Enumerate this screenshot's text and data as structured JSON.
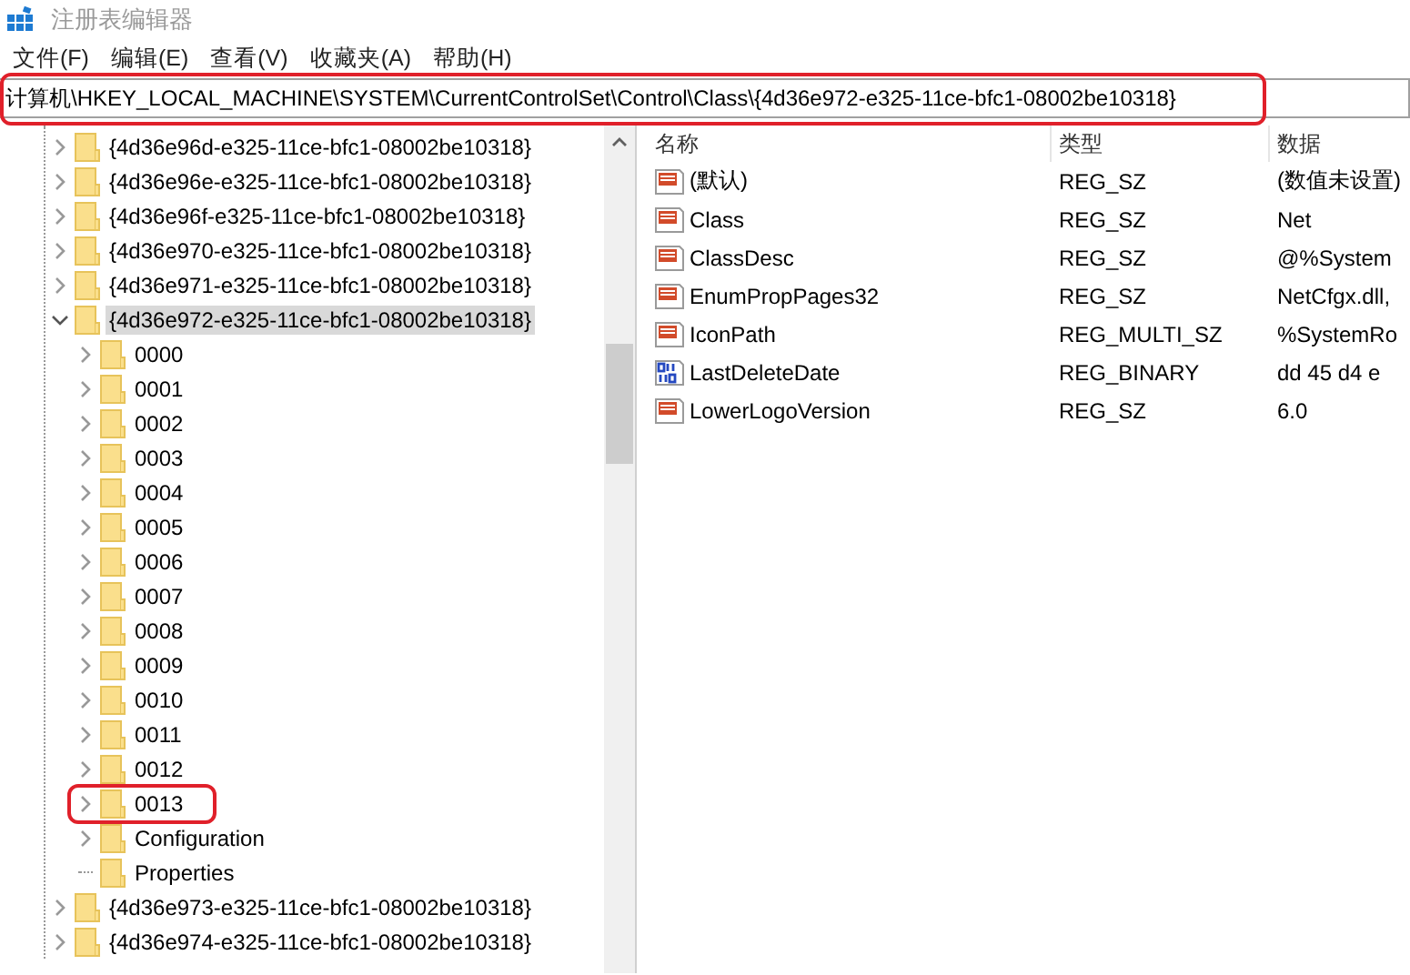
{
  "window": {
    "title": "注册表编辑器"
  },
  "menu": [
    {
      "label": "文件(F)"
    },
    {
      "label": "编辑(E)"
    },
    {
      "label": "查看(V)"
    },
    {
      "label": "收藏夹(A)"
    },
    {
      "label": "帮助(H)"
    }
  ],
  "address_bar": {
    "value": "计算机\\HKEY_LOCAL_MACHINE\\SYSTEM\\CurrentControlSet\\Control\\Class\\{4d36e972-e325-11ce-bfc1-08002be10318}",
    "annotated": true
  },
  "tree": [
    {
      "label": "{4d36e96d-e325-11ce-bfc1-08002be10318}",
      "expanded": false,
      "selected": false,
      "annotated": false,
      "has_children": true
    },
    {
      "label": "{4d36e96e-e325-11ce-bfc1-08002be10318}",
      "expanded": false,
      "selected": false,
      "annotated": false,
      "has_children": true
    },
    {
      "label": "{4d36e96f-e325-11ce-bfc1-08002be10318}",
      "expanded": false,
      "selected": false,
      "annotated": false,
      "has_children": true
    },
    {
      "label": "{4d36e970-e325-11ce-bfc1-08002be10318}",
      "expanded": false,
      "selected": false,
      "annotated": false,
      "has_children": true
    },
    {
      "label": "{4d36e971-e325-11ce-bfc1-08002be10318}",
      "expanded": false,
      "selected": false,
      "annotated": false,
      "has_children": true
    },
    {
      "label": "{4d36e972-e325-11ce-bfc1-08002be10318}",
      "expanded": true,
      "selected": true,
      "annotated": false,
      "has_children": true,
      "children": [
        {
          "label": "0000",
          "expanded": false,
          "selected": false,
          "annotated": false,
          "has_children": true
        },
        {
          "label": "0001",
          "expanded": false,
          "selected": false,
          "annotated": false,
          "has_children": true
        },
        {
          "label": "0002",
          "expanded": false,
          "selected": false,
          "annotated": false,
          "has_children": true
        },
        {
          "label": "0003",
          "expanded": false,
          "selected": false,
          "annotated": false,
          "has_children": true
        },
        {
          "label": "0004",
          "expanded": false,
          "selected": false,
          "annotated": false,
          "has_children": true
        },
        {
          "label": "0005",
          "expanded": false,
          "selected": false,
          "annotated": false,
          "has_children": true
        },
        {
          "label": "0006",
          "expanded": false,
          "selected": false,
          "annotated": false,
          "has_children": true
        },
        {
          "label": "0007",
          "expanded": false,
          "selected": false,
          "annotated": false,
          "has_children": true
        },
        {
          "label": "0008",
          "expanded": false,
          "selected": false,
          "annotated": false,
          "has_children": true
        },
        {
          "label": "0009",
          "expanded": false,
          "selected": false,
          "annotated": false,
          "has_children": true
        },
        {
          "label": "0010",
          "expanded": false,
          "selected": false,
          "annotated": false,
          "has_children": true
        },
        {
          "label": "0011",
          "expanded": false,
          "selected": false,
          "annotated": false,
          "has_children": true
        },
        {
          "label": "0012",
          "expanded": false,
          "selected": false,
          "annotated": false,
          "has_children": true
        },
        {
          "label": "0013",
          "expanded": false,
          "selected": false,
          "annotated": true,
          "has_children": true
        },
        {
          "label": "Configuration",
          "expanded": false,
          "selected": false,
          "annotated": false,
          "has_children": true
        },
        {
          "label": "Properties",
          "selected": false,
          "annotated": false,
          "has_children": false
        }
      ]
    },
    {
      "label": "{4d36e973-e325-11ce-bfc1-08002be10318}",
      "expanded": false,
      "selected": false,
      "annotated": false,
      "has_children": true
    },
    {
      "label": "{4d36e974-e325-11ce-bfc1-08002be10318}",
      "expanded": false,
      "selected": false,
      "annotated": false,
      "has_children": true
    }
  ],
  "values": {
    "columns": [
      "名称",
      "类型",
      "数据"
    ],
    "rows": [
      {
        "kind": "string",
        "name": "(默认)",
        "type": "REG_SZ",
        "data": "(数值未设置)"
      },
      {
        "kind": "string",
        "name": "Class",
        "type": "REG_SZ",
        "data": "Net"
      },
      {
        "kind": "string",
        "name": "ClassDesc",
        "type": "REG_SZ",
        "data": "@%System"
      },
      {
        "kind": "string",
        "name": "EnumPropPages32",
        "type": "REG_SZ",
        "data": "NetCfgx.dll,"
      },
      {
        "kind": "string",
        "name": "IconPath",
        "type": "REG_MULTI_SZ",
        "data": "%SystemRo"
      },
      {
        "kind": "binary",
        "name": "LastDeleteDate",
        "type": "REG_BINARY",
        "data": "dd 45 d4 e"
      },
      {
        "kind": "string",
        "name": "LowerLogoVersion",
        "type": "REG_SZ",
        "data": "6.0"
      }
    ]
  }
}
